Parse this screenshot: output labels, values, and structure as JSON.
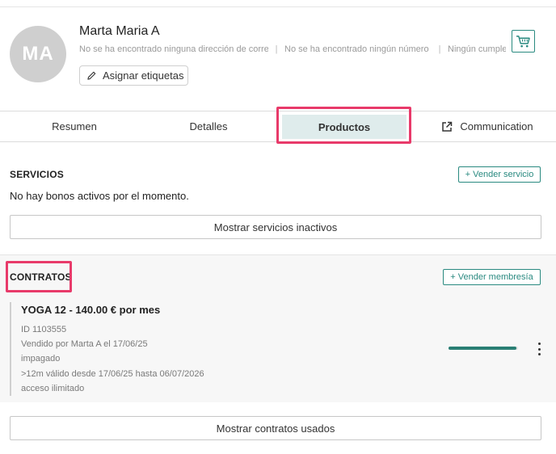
{
  "profile": {
    "initials": "MA",
    "name": "Marta Maria A",
    "meta": [
      "No se ha encontrado ninguna dirección de correo",
      "No se ha encontrado ningún número de teléfono",
      "Ningún cumpleaños"
    ],
    "tag_button_label": "Asignar etiquetas"
  },
  "tabs": [
    {
      "label": "Resumen"
    },
    {
      "label": "Detalles"
    },
    {
      "label": "Productos",
      "active": true
    },
    {
      "label": "Communication"
    }
  ],
  "services": {
    "title": "SERVICIOS",
    "sell_button": "+ Vender servicio",
    "empty_message": "No hay bonos activos por el momento.",
    "show_inactive_button": "Mostrar servicios inactivos"
  },
  "contracts": {
    "title": "CONTRATOS",
    "sell_button": "+ Vender membresía",
    "items": [
      {
        "title": "YOGA 12 - 140.00 € por mes",
        "id": "ID 1103555",
        "sold_by": "Vendido por Marta A el 17/06/25",
        "status": "impagado",
        "validity": ">12m válido desde 17/06/25 hasta 06/07/2026",
        "access": "acceso ilimitado",
        "progress_fraction": 0.98
      }
    ],
    "show_used_button": "Mostrar contratos usados"
  },
  "colors": {
    "accent": "#2a8a80",
    "highlight": "#e83a6a",
    "active_tab_bg": "#dfecec",
    "avatar_bg": "#cfcfcf"
  },
  "icons": [
    "pencil-icon",
    "shopping-cart-icon",
    "external-link-icon",
    "more-vertical-icon"
  ]
}
